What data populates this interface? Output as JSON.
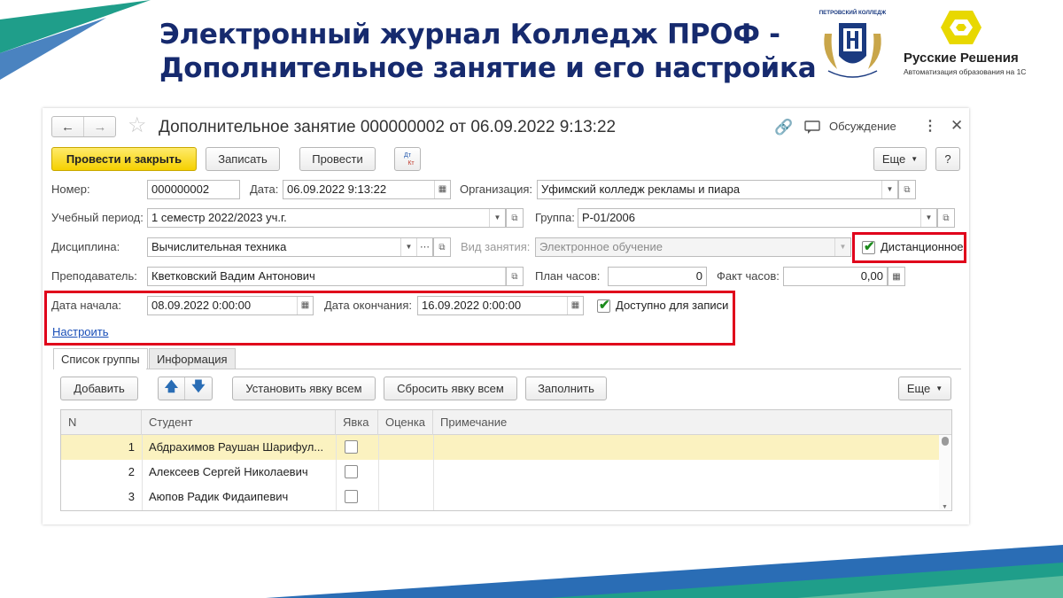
{
  "slide": {
    "title_line1": "Электронный журнал Колледж ПРОФ -",
    "title_line2": "Дополнительное занятие и его настройка",
    "college_logo_text": "ПЕТРОВСКИЙ КОЛЛЕДЖ",
    "partner_name": "Русские Решения",
    "partner_tagline": "Автоматизация образования на 1С",
    "colors": {
      "title": "#162a6e",
      "accent_teal": "#1f9e8a",
      "accent_blue": "#2a6db5",
      "highlight": "#e0001b",
      "primary_button": "#f5d000"
    }
  },
  "window": {
    "title": "Дополнительное занятие 000000002 от 06.09.2022 9:13:22",
    "discussion_label": "Обсуждение",
    "icons": [
      "back-icon",
      "forward-icon",
      "star-icon",
      "link-icon",
      "discussion-icon",
      "more-vert-icon",
      "close-icon"
    ]
  },
  "toolbar": {
    "post_and_close": "Провести и закрыть",
    "save": "Записать",
    "post": "Провести",
    "dtkt_top": "Дт",
    "dtkt_bottom": "Кт",
    "more": "Еще",
    "help": "?"
  },
  "form": {
    "number_label": "Номер:",
    "number_value": "000000002",
    "date_label": "Дата:",
    "date_value": "06.09.2022  9:13:22",
    "org_label": "Организация:",
    "org_value": "Уфимский колледж рекламы и пиара",
    "period_label": "Учебный период:",
    "period_value": "1 семестр 2022/2023 уч.г.",
    "group_label": "Группа:",
    "group_value": "Р-01/2006",
    "discipline_label": "Дисциплина:",
    "discipline_value": "Вычислительная техника",
    "lesson_type_label": "Вид занятия:",
    "lesson_type_value": "Электронное обучение",
    "remote_label": "Дистанционное",
    "remote_checked": true,
    "teacher_label": "Преподаватель:",
    "teacher_value": "Кветковский Вадим Антонович",
    "plan_hours_label": "План часов:",
    "plan_hours_value": "0",
    "fact_hours_label": "Факт часов:",
    "fact_hours_value": "0,00",
    "start_label": "Дата начала:",
    "start_value": "08.09.2022  0:00:00",
    "end_label": "Дата окончания:",
    "end_value": "16.09.2022  0:00:00",
    "available_label": "Доступно для записи",
    "available_checked": true,
    "configure_link": "Настроить"
  },
  "tabs": [
    {
      "label": "Список группы",
      "active": true
    },
    {
      "label": "Информация",
      "active": false
    }
  ],
  "group_toolbar": {
    "add": "Добавить",
    "set_attendance": "Установить явку всем",
    "reset_attendance": "Сбросить явку всем",
    "fill": "Заполнить",
    "more": "Еще"
  },
  "table": {
    "columns": [
      "N",
      "Студент",
      "Явка",
      "Оценка",
      "Примечание"
    ],
    "rows": [
      {
        "n": "1",
        "student": "Абдрахимов Раушан Шарифул...",
        "present": false,
        "grade": "",
        "note": "",
        "selected": true
      },
      {
        "n": "2",
        "student": "Алексеев Сергей Николаевич",
        "present": false,
        "grade": "",
        "note": "",
        "selected": false
      },
      {
        "n": "3",
        "student": "Аюпов Радик Фидаипевич",
        "present": false,
        "grade": "",
        "note": "",
        "selected": false
      }
    ]
  }
}
